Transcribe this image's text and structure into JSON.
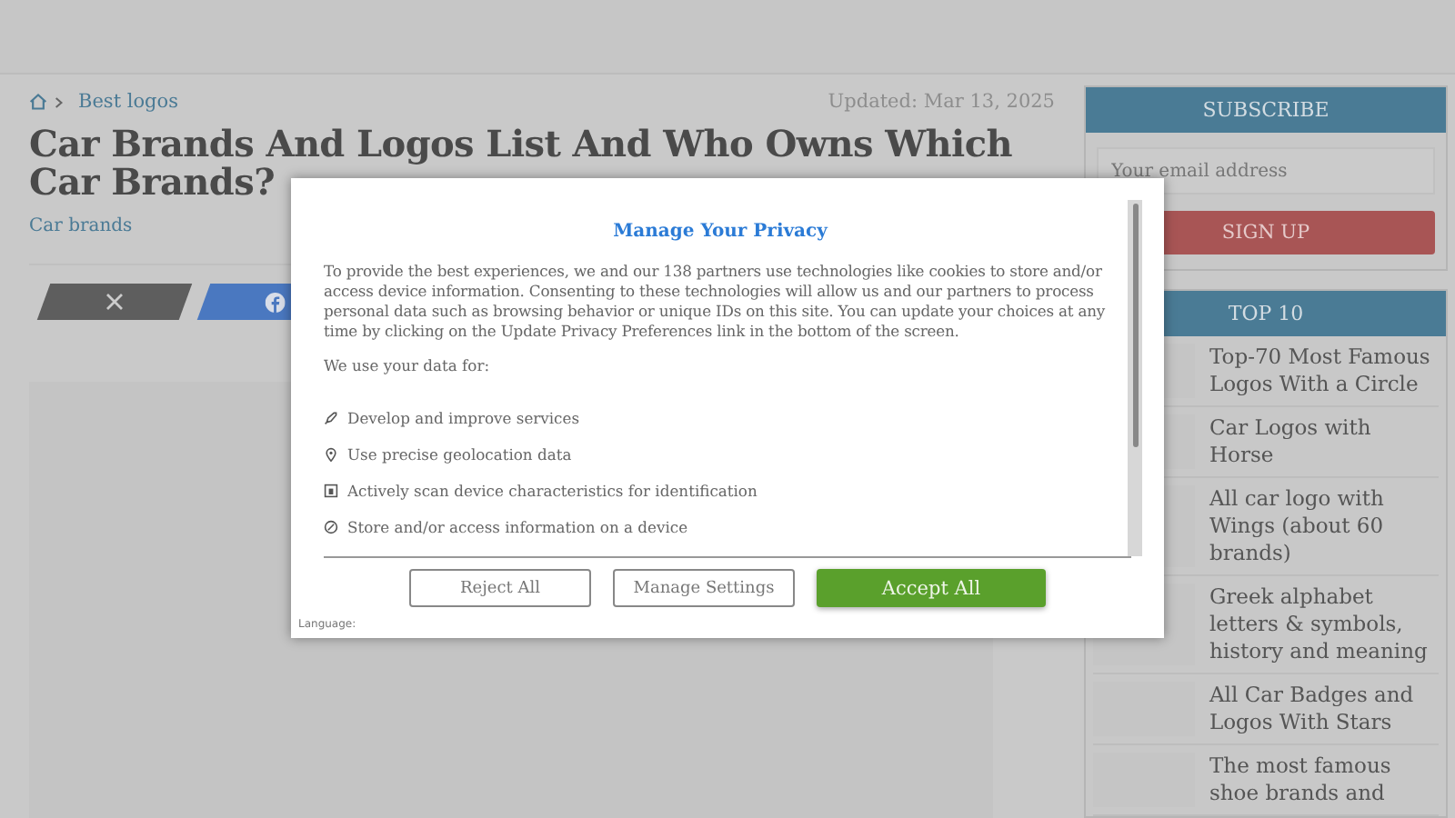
{
  "breadcrumb": {
    "link": "Best logos"
  },
  "updated": "Updated: Mar 13, 2025",
  "article": {
    "title": "Car Brands And Logos List And Who Owns Which Car Brands?",
    "category": "Car brands"
  },
  "sidebar": {
    "subscribe": {
      "heading": "SUBSCRIBE",
      "placeholder": "Your email address",
      "button": "SIGN UP"
    },
    "top10": {
      "heading": "TOP 10",
      "items": [
        {
          "title": "Top-70 Most Famous Logos With a Circle"
        },
        {
          "title": "Car Logos with Horse"
        },
        {
          "title": "All car logo with Wings (about 60 brands)"
        },
        {
          "title": "Greek alphabet letters & symbols, history and meaning"
        },
        {
          "title": "All Car Badges and Logos With Stars"
        },
        {
          "title": "The most famous shoe brands and"
        }
      ]
    }
  },
  "dialog": {
    "title": "Manage Your Privacy",
    "intro": "To provide the best experiences, we and our 138 partners use technologies like cookies to store and/or access device information. Consenting to these technologies will allow us and our partners to process personal data such as browsing behavior or unique IDs on this site. You can update your choices at any time by clicking on the Update Privacy Preferences link in the bottom of the screen.",
    "purposes_label": "We use your data for:",
    "purposes": [
      "Develop and improve services",
      "Use precise geolocation data",
      "Actively scan device characteristics for identification",
      "Store and/or access information on a device"
    ],
    "buttons": [
      {
        "label": "Reject All",
        "kind": "outline"
      },
      {
        "label": "Manage Settings",
        "kind": "outline"
      },
      {
        "label": "Accept All",
        "kind": "primary"
      }
    ],
    "language_label": "Language:"
  }
}
